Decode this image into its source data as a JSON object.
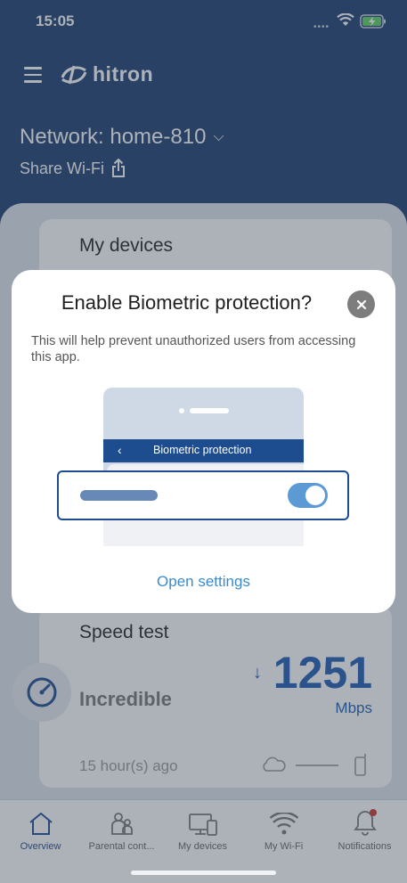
{
  "status_bar": {
    "time": "15:05"
  },
  "header": {
    "logo": "hitron",
    "network_title": "Network: home-810",
    "share_label": "Share Wi-Fi"
  },
  "cards": {
    "devices_title": "My devices",
    "speed": {
      "title": "Speed test",
      "rating": "Incredible",
      "value": "1251",
      "unit": "Mbps",
      "last_run": "15 hour(s) ago"
    }
  },
  "tabs": [
    {
      "label": "Overview",
      "icon": "home-icon",
      "active": true
    },
    {
      "label": "Parental cont...",
      "icon": "parental-icon"
    },
    {
      "label": "My devices",
      "icon": "devices-icon"
    },
    {
      "label": "My Wi-Fi",
      "icon": "wifi-icon"
    },
    {
      "label": "Notifications",
      "icon": "bell-icon",
      "badge": true
    }
  ],
  "modal": {
    "title": "Enable Biometric protection?",
    "body": "This will help prevent unauthorized users from accessing this app.",
    "illustration_nav": "Biometric protection",
    "action": "Open settings"
  },
  "colors": {
    "primary": "#1d4c8f",
    "link": "#3b8bcc",
    "speed": "#1d5db0",
    "badge": "#d0342c"
  }
}
